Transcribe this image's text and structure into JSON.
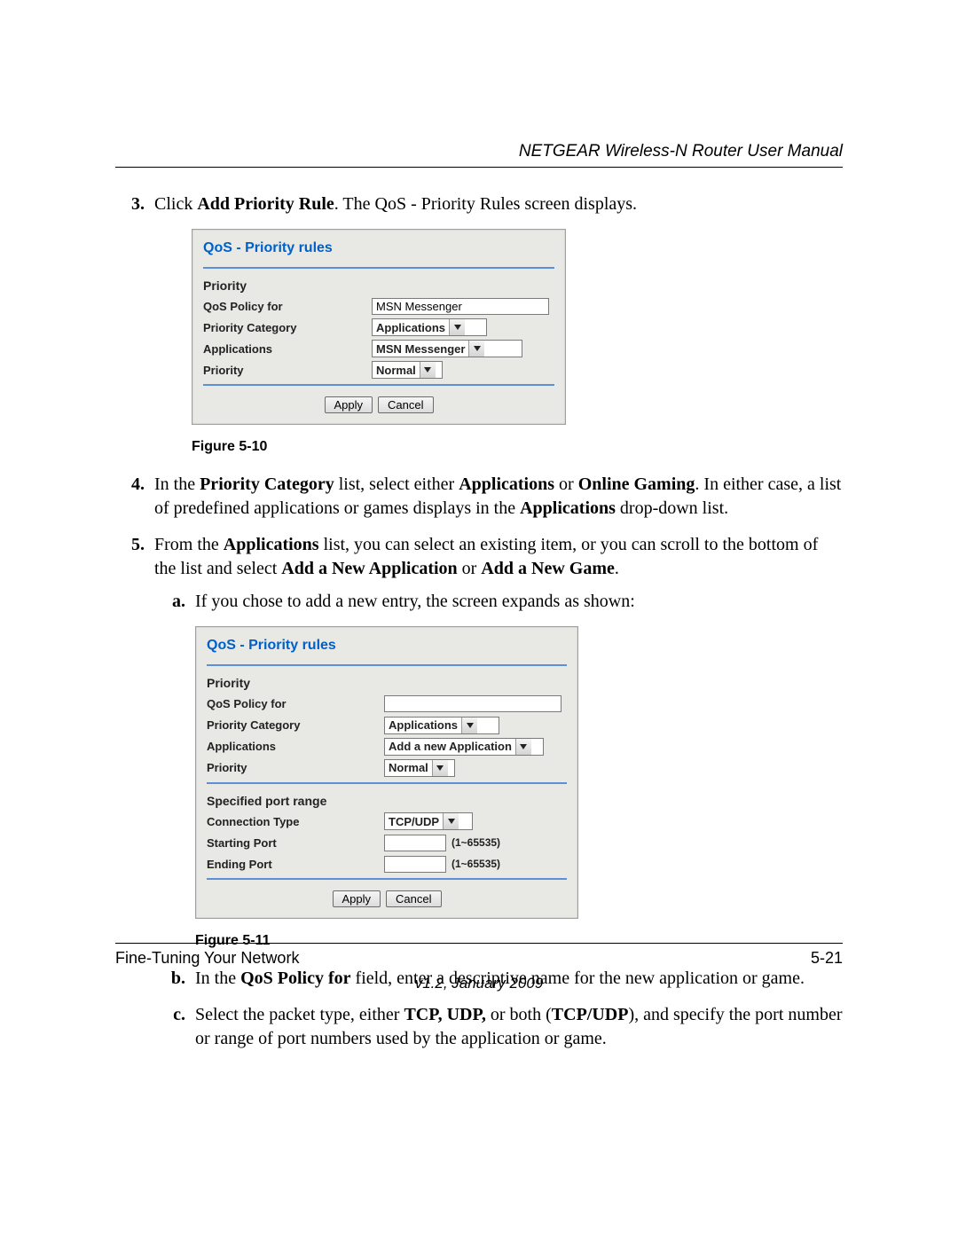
{
  "header": {
    "doc_title": "NETGEAR Wireless-N Router User Manual"
  },
  "steps": {
    "s3_pre": "Click ",
    "s3_bold1": "Add Priority Rule",
    "s3_post": ". The QoS - Priority Rules screen displays.",
    "s4_a": "In the ",
    "s4_b1": "Priority Category",
    "s4_b": " list, select either ",
    "s4_b2": "Applications",
    "s4_c": " or ",
    "s4_b3": "Online Gaming",
    "s4_d": ". In either case, a list of predefined applications or games displays in the ",
    "s4_b4": "Applications",
    "s4_e": " drop-down list.",
    "s5_a": "From the ",
    "s5_b1": "Applications",
    "s5_b": " list, you can select an existing item, or you can scroll to the bottom of the list and select ",
    "s5_b2": "Add a New Application",
    "s5_c": " or ",
    "s5_b3": "Add a New Game",
    "s5_d": ".",
    "sa_text": "If you chose to add a new entry, the screen expands as shown:",
    "sb_a": "In the ",
    "sb_b1": "QoS Policy for",
    "sb_b": " field, enter a descriptive name for the new application or game.",
    "sc_a": "Select the packet type, either ",
    "sc_b1": "TCP, UDP,",
    "sc_b": " or both (",
    "sc_b2": "TCP/UDP",
    "sc_c": "), and specify the port number or range of port numbers used by the application or game."
  },
  "figcap": {
    "f10": "Figure 5-10",
    "f11": "Figure 5-11"
  },
  "panel1": {
    "title": "QoS - Priority rules",
    "sec_priority": "Priority",
    "lbl_policy": "QoS Policy for",
    "val_policy": "MSN Messenger",
    "lbl_cat": "Priority Category",
    "val_cat": "Applications",
    "lbl_apps": "Applications",
    "val_apps": "MSN Messenger",
    "lbl_prio": "Priority",
    "val_prio": "Normal",
    "btn_apply": "Apply",
    "btn_cancel": "Cancel"
  },
  "panel2": {
    "title": "QoS - Priority rules",
    "sec_priority": "Priority",
    "lbl_policy": "QoS Policy for",
    "val_policy": "",
    "lbl_cat": "Priority Category",
    "val_cat": "Applications",
    "lbl_apps": "Applications",
    "val_apps": "Add a new Application",
    "lbl_prio": "Priority",
    "val_prio": "Normal",
    "sec_port": "Specified port range",
    "lbl_conn": "Connection Type",
    "val_conn": "TCP/UDP",
    "lbl_start": "Starting Port",
    "lbl_end": "Ending Port",
    "port_hint": "(1~65535)",
    "btn_apply": "Apply",
    "btn_cancel": "Cancel"
  },
  "footer": {
    "section": "Fine-Tuning Your Network",
    "pagenum": "5-21",
    "version": "v1.2, January 2009"
  }
}
